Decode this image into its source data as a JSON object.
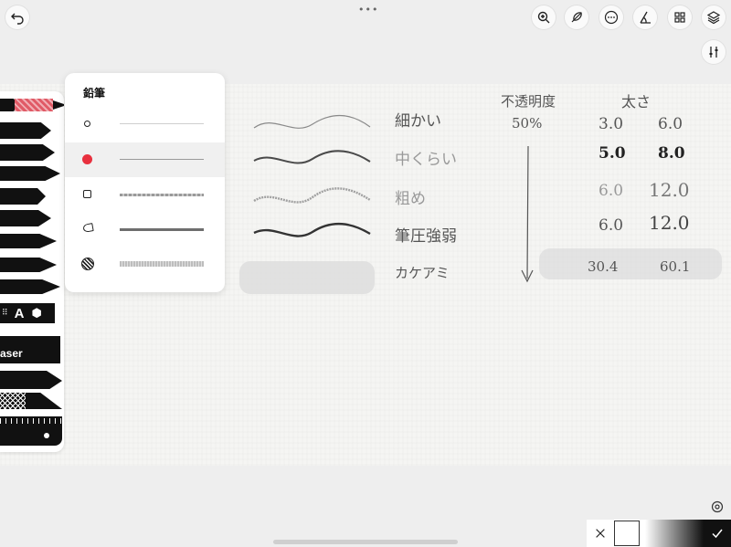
{
  "toolbar": {
    "more_dots": "•••",
    "icons": [
      "undo-icon",
      "zoom-icon",
      "brush-icon",
      "more-icon",
      "ruler-icon",
      "grid-icon",
      "layers-icon",
      "adjust-icon"
    ]
  },
  "pen_panel": {
    "title": "鉛筆",
    "rows": [
      {
        "name": "thin-pencil",
        "selected": false
      },
      {
        "name": "medium-pencil",
        "selected": true
      },
      {
        "name": "rough-pencil",
        "selected": false
      },
      {
        "name": "pressure-pencil",
        "selected": false
      },
      {
        "name": "hatch-pencil",
        "selected": false
      }
    ]
  },
  "toolstrip": {
    "letter_a": "A",
    "eraser_label": "aser"
  },
  "canvas_text": {
    "rows": [
      {
        "label": "細かい",
        "v1": "3.0",
        "v2": "6.0"
      },
      {
        "label": "中くらい",
        "v1": "5.0",
        "v2": "8.0"
      },
      {
        "label": "粗め",
        "v1": "6.0",
        "v2": "12.0"
      },
      {
        "label": "筆圧強弱",
        "v1": "6.0",
        "v2": "12.0"
      },
      {
        "label": "カケアミ",
        "v1": "30.4",
        "v2": "60.1"
      }
    ],
    "opacity_header": "不透明度",
    "opacity_value": "50%",
    "size_header": "太さ"
  },
  "colors": {
    "accent_red": "#e8303e",
    "ink": "#111111"
  }
}
